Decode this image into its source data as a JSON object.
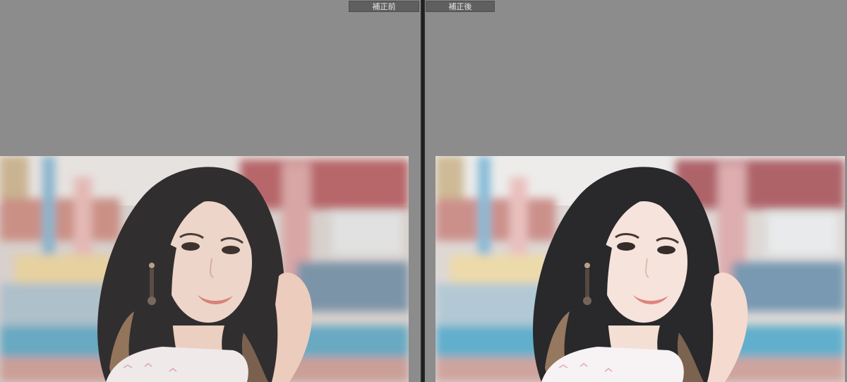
{
  "panes": {
    "before": {
      "label": "補正前"
    },
    "after": {
      "label": "補正後"
    }
  },
  "photo": {
    "description_icon": "portrait-photo",
    "before_tone": "#d7c6bd",
    "after_tone": "#e4d9d3"
  },
  "colors": {
    "background": "#8b8b8b",
    "divider": "#2b2b2b",
    "label_bg": "#5f5f5f",
    "label_text": "#e6e6e6"
  }
}
